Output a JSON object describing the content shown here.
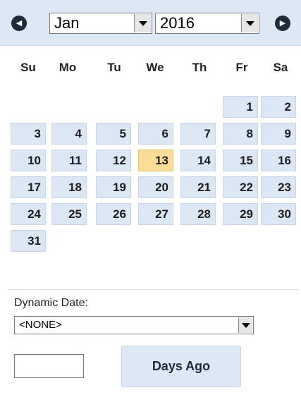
{
  "header": {
    "prev_icon": "chevron-left-icon",
    "prev_glyph": "◀",
    "next_icon": "chevron-right-icon",
    "next_glyph": "▶",
    "month": "Jan",
    "year": "2016"
  },
  "weekdays": [
    "Su",
    "Mo",
    "Tu",
    "We",
    "Th",
    "Fr",
    "Sa"
  ],
  "days": [
    "1",
    "2",
    "3",
    "4",
    "5",
    "6",
    "7",
    "8",
    "9",
    "10",
    "11",
    "12",
    "13",
    "14",
    "15",
    "16",
    "17",
    "18",
    "19",
    "20",
    "21",
    "22",
    "23",
    "24",
    "25",
    "26",
    "27",
    "28",
    "29",
    "30",
    "31"
  ],
  "today": "13",
  "colors": {
    "day_bg": "#dbe7f5",
    "today_bg": "#fbdc96",
    "header_bg": "#dce8f6"
  },
  "dynamic": {
    "label": "Dynamic Date:",
    "selected": "<NONE>",
    "days_input_value": "",
    "days_ago_label": "Days Ago"
  }
}
